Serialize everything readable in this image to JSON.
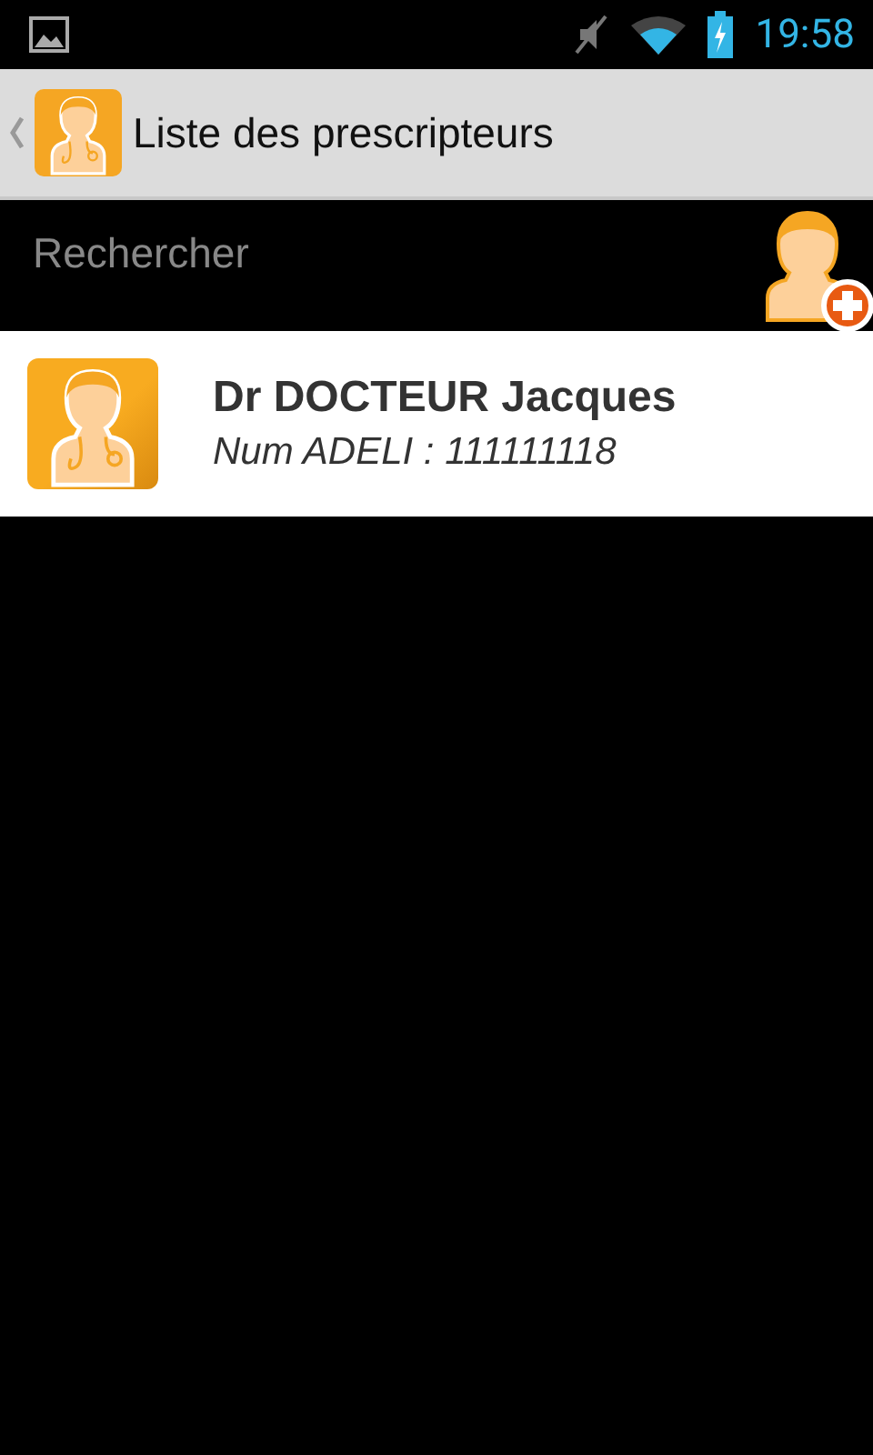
{
  "status_bar": {
    "time": "19:58"
  },
  "action_bar": {
    "title": "Liste des prescripteurs"
  },
  "search": {
    "placeholder": "Rechercher"
  },
  "prescribers": [
    {
      "name": "Dr DOCTEUR Jacques",
      "adeli": "Num ADELI : 111111118"
    }
  ]
}
